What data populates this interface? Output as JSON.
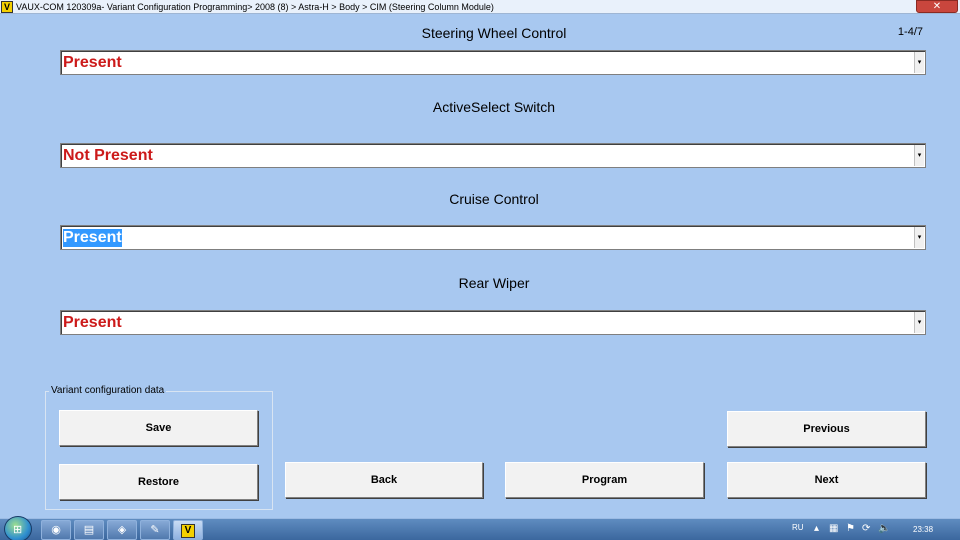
{
  "window": {
    "logo": "V",
    "title": "VAUX-COM 120309a- Variant Configuration Programming> 2008 (8) > Astra-H > Body > CIM (Steering Column Module)",
    "close_glyph": "✕"
  },
  "page_counter": "1-4/7",
  "fields": [
    {
      "label": "Steering Wheel Control",
      "value": "Present"
    },
    {
      "label": "ActiveSelect Switch",
      "value": "Not Present"
    },
    {
      "label": "Cruise Control",
      "value": "Present"
    },
    {
      "label": "Rear Wiper",
      "value": "Present"
    }
  ],
  "dropdown_arrow": "▾",
  "group": {
    "legend": "Variant configuration data",
    "save_label": "Save",
    "restore_label": "Restore"
  },
  "nav": {
    "back_label": "Back",
    "program_label": "Program",
    "previous_label": "Previous",
    "next_label": "Next"
  },
  "taskbar": {
    "start_glyph": "⊞",
    "items": [
      {
        "icon": "chrome-icon",
        "glyph": "◉"
      },
      {
        "icon": "explorer-icon",
        "glyph": "▤"
      },
      {
        "icon": "app-icon",
        "glyph": "◈"
      },
      {
        "icon": "paint-icon",
        "glyph": "✎"
      },
      {
        "icon": "vauxcom-icon",
        "glyph": "V"
      }
    ],
    "language": "RU",
    "tray": [
      {
        "icon": "tray-up-arrow-icon",
        "glyph": "▴"
      },
      {
        "icon": "network-icon",
        "glyph": "▦"
      },
      {
        "icon": "flag-icon",
        "glyph": "⚑"
      },
      {
        "icon": "update-icon",
        "glyph": "⟳"
      },
      {
        "icon": "volume-icon",
        "glyph": "🔈"
      }
    ],
    "clock": "23:38"
  },
  "colors": {
    "background": "#a8c8f0",
    "value_text": "#cc1a1a",
    "selection": "#3399ff"
  }
}
